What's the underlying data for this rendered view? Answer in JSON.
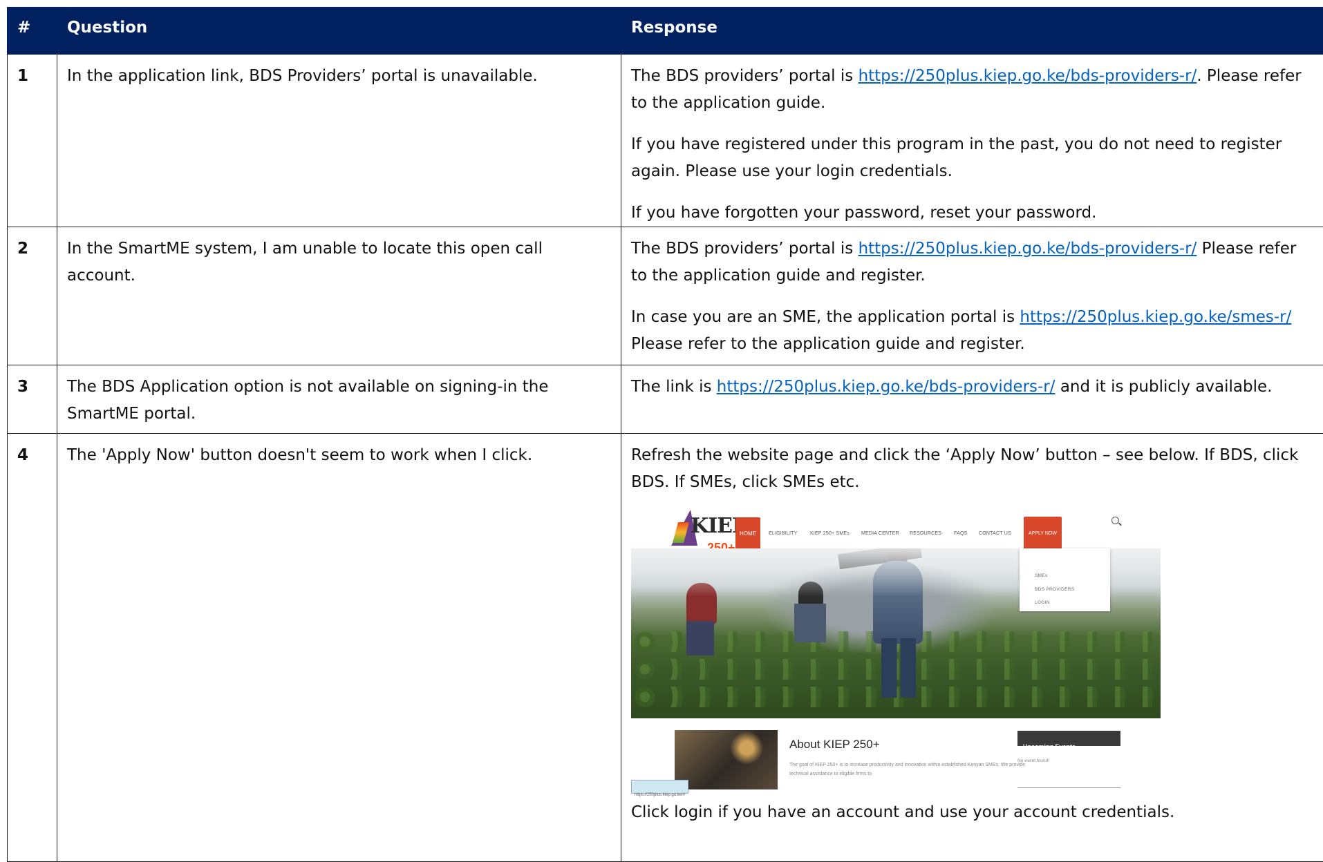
{
  "table": {
    "headers": [
      "#",
      "Question",
      "Response"
    ],
    "rows": [
      {
        "num": "1",
        "question": "In the application link, BDS Providers’ portal is unavailable.",
        "response": [
          {
            "pre": "The BDS providers’ portal is ",
            "link": "https://250plus.kiep.go.ke/bds-providers-r/",
            "post": ". Please refer to the application guide."
          },
          {
            "pre": "If you have registered under this program in the past, you do not need to register again. Please use your login credentials."
          },
          {
            "pre": "If you have forgotten your password, reset your password."
          }
        ]
      },
      {
        "num": "2",
        "question": "In the SmartME system, I am unable to locate this open call account.",
        "response": [
          {
            "pre": "The BDS providers’ portal is ",
            "link": "https://250plus.kiep.go.ke/bds-providers-r/",
            "post": " Please refer to the application guide and register."
          },
          {
            "pre": "In case you are an SME, the application portal is ",
            "link": "https://250plus.kiep.go.ke/smes-r/",
            "post": " Please refer to the application guide and register."
          }
        ]
      },
      {
        "num": "3",
        "question": "The BDS Application option is not available on signing-in the SmartME portal.",
        "response": [
          {
            "pre": "The link is ",
            "link": "https://250plus.kiep.go.ke/bds-providers-r/",
            "post": " and it is publicly available."
          }
        ]
      },
      {
        "num": "4",
        "question": "The 'Apply Now' button doesn't seem to work when I click.",
        "response": [
          {
            "pre": "Refresh the website page and click the ‘Apply Now’ button – see below. If BDS, click BDS. If SMEs, click SMEs etc."
          }
        ],
        "after_image": "Click login if you have an account and use your account credentials."
      }
    ]
  },
  "screenshot": {
    "logo": "KIEP",
    "logo_sub": "250+",
    "nav": [
      "HOME",
      "ELIGIBILITY",
      "KIEP 250+ SMEs",
      "MEDIA CENTER",
      "RESOURCES",
      "FAQS",
      "CONTACT US",
      "APPLY NOW"
    ],
    "menu": [
      "SMEs",
      "BDS PROVIDERS",
      "LOGIN"
    ],
    "about_title": "About KIEP 250+",
    "about_text": "The goal of KIEP 250+ is to increase productivity and innovation within established Kenyan SMEs. We provide technical assistance to eligible firms to",
    "url_hint": "https://250plus.kiep.go.ke/#",
    "events_title": "Upcoming Events",
    "events_empty": "No event found!"
  },
  "colors": {
    "header_bg": "#002060",
    "link": "#0563c1",
    "accent": "#d9472b"
  }
}
